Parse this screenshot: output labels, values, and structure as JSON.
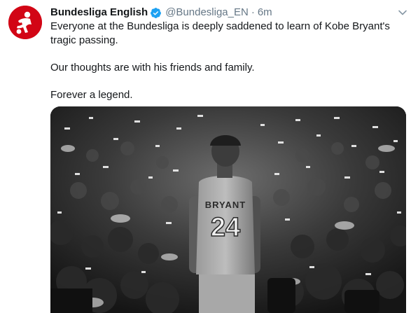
{
  "tweet": {
    "display_name": "Bundesliga English",
    "handle": "@Bundesliga_EN",
    "separator": "·",
    "time": "6m",
    "lines": [
      "Everyone at the Bundesliga is deeply saddened to learn of Kobe Bryant's",
      "tragic passing.",
      "",
      "Our thoughts are with his friends and family.",
      "",
      "Forever a legend."
    ],
    "media": {
      "jersey_name": "BRYANT",
      "jersey_number": "24"
    }
  },
  "colors": {
    "avatar_bg": "#d20515",
    "verified": "#1da1f2",
    "secondary_text": "#657786"
  },
  "icons": {
    "avatar": "bundesliga-logo-icon",
    "verified": "verified-badge-icon",
    "more": "chevron-down-icon"
  }
}
